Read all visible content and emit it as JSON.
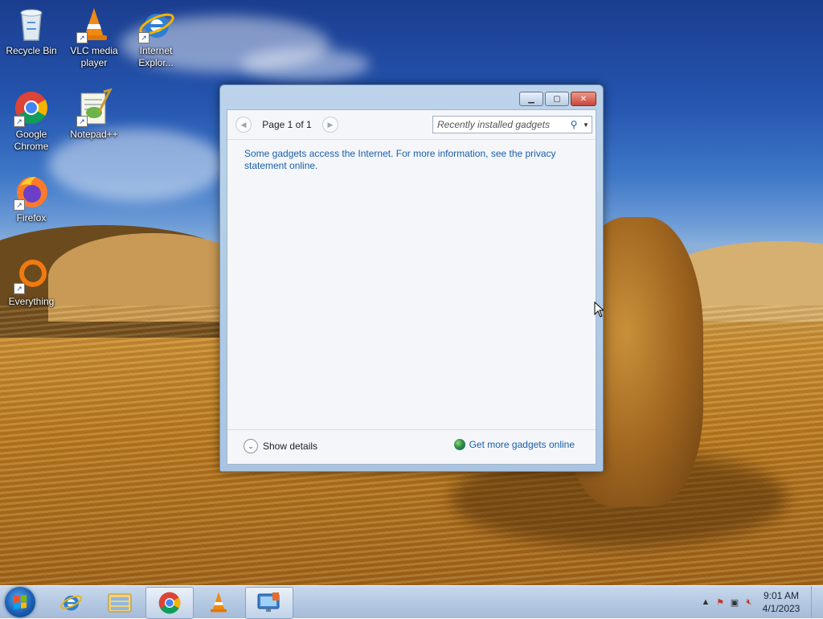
{
  "desktop": {
    "icons": [
      {
        "label": "Recycle Bin"
      },
      {
        "label": "VLC media player"
      },
      {
        "label": "Internet Explor..."
      },
      {
        "label": "Google Chrome"
      },
      {
        "label": "Notepad++"
      },
      {
        "label": "Firefox"
      },
      {
        "label": "Everything"
      }
    ]
  },
  "gadgets_window": {
    "pager_label": "Page 1 of 1",
    "search_placeholder": "Recently installed gadgets",
    "notice": "Some gadgets access the Internet.  For more information, see the privacy statement online.",
    "show_details": "Show details",
    "get_more": "Get more gadgets online"
  },
  "taskbar": {
    "apps": [
      {
        "icon": "internet-explorer-icon"
      },
      {
        "icon": "file-explorer-icon"
      },
      {
        "icon": "chrome-icon"
      },
      {
        "icon": "vlc-icon"
      },
      {
        "icon": "gadgets-icon",
        "active": true
      }
    ],
    "clock": {
      "time": "9:01 AM",
      "date": "4/1/2023"
    }
  },
  "colors": {
    "link": "#1a5eab",
    "taskbar": "#b4c9e2",
    "accent": "#1a5fb4"
  }
}
